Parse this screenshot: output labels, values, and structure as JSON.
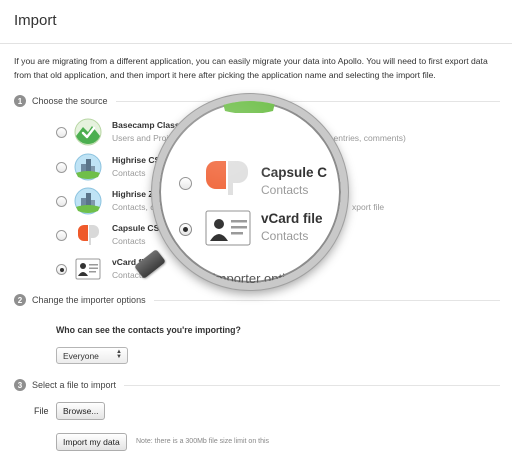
{
  "header": {
    "title": "Import"
  },
  "intro": {
    "text": "If you are migrating from a different application, you can easily migrate your data into Apollo. You will need to first export data from that old application, and then import it here after picking the application name and selecting the import file."
  },
  "sections": [
    {
      "number": "1",
      "title": "Choose the source"
    },
    {
      "number": "2",
      "title": "Change the importer options"
    },
    {
      "number": "3",
      "title": "Select a file to import"
    }
  ],
  "sources": [
    {
      "name": "Basecamp Classic",
      "desc": "Users and Projects (messages, task lists, milestones, time entries, comments)",
      "icon": "basecamp-icon",
      "selected": false
    },
    {
      "name": "Highrise CSV file",
      "desc": "Contacts",
      "icon": "highrise-icon",
      "selected": false
    },
    {
      "name": "Highrise ZIP f",
      "desc": "Contacts, ca",
      "desc_tail": "xport file",
      "icon": "highrise-icon",
      "selected": false
    },
    {
      "name": "Capsule CS",
      "desc": "Contacts",
      "icon": "capsule-icon",
      "selected": false
    },
    {
      "name": "vCard file",
      "desc": "Contacts",
      "icon": "vcard-icon",
      "selected": true
    }
  ],
  "magnifier": {
    "capsule_name": "Capsule C",
    "capsule_desc": "Contacts",
    "vcard_name": "vCard file",
    "vcard_desc": "Contacts",
    "section_text": "ge the importer options"
  },
  "options": {
    "visibility_label": "Who can see the contacts you're importing?",
    "visibility_value": "Everyone"
  },
  "file": {
    "label": "File",
    "browse_label": "Browse...",
    "import_label": "Import my data",
    "note": "Note: there is a 300Mb file size limit on this"
  },
  "colors": {
    "basecamp": "#4caf50",
    "highrise_sky": "#7fc4e8",
    "capsule": "#ef5a2b",
    "badge": "#8f8f8f"
  }
}
